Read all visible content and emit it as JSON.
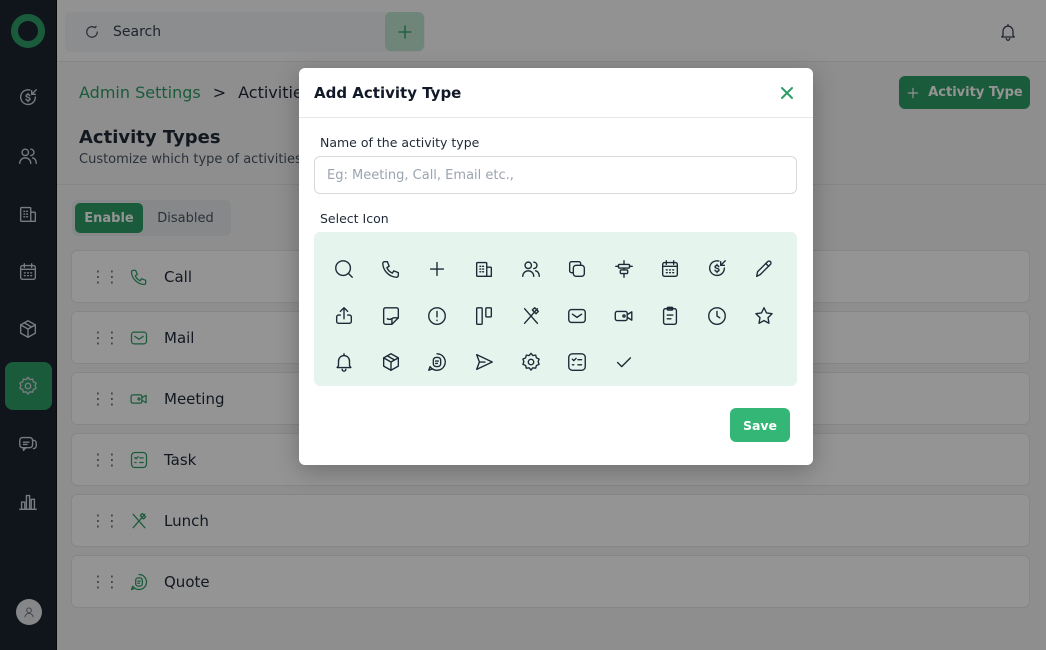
{
  "topbar": {
    "search_placeholder": "Search"
  },
  "breadcrumb": {
    "parent": "Admin Settings",
    "separator": ">",
    "current": "Activities"
  },
  "header": {
    "add_button_label": "Activity Type",
    "title": "Activity Types",
    "subtitle": "Customize which type of activities y"
  },
  "toggle": {
    "enable_label": "Enable",
    "disabled_label": "Disabled"
  },
  "activity_rows": [
    {
      "label": "Call",
      "icon": "phone-icon"
    },
    {
      "label": "Mail",
      "icon": "mail-icon"
    },
    {
      "label": "Meeting",
      "icon": "video-icon"
    },
    {
      "label": "Task",
      "icon": "task-icon"
    },
    {
      "label": "Lunch",
      "icon": "cutlery-icon"
    },
    {
      "label": "Quote",
      "icon": "quote-icon"
    }
  ],
  "modal": {
    "title": "Add Activity Type",
    "name_label": "Name of the activity type",
    "name_value": "",
    "name_placeholder": "Eg: Meeting, Call, Email etc.,",
    "icon_label": "Select Icon",
    "save_label": "Save",
    "icons": [
      "search-icon",
      "phone-icon",
      "plus-icon",
      "building-icon",
      "users-icon",
      "copy-icon",
      "align-center-icon",
      "calendar-icon",
      "dollar-refund-icon",
      "pencil-icon",
      "upload-icon",
      "sticky-note-icon",
      "alert-circle-icon",
      "columns-icon",
      "cutlery-icon",
      "mail-icon",
      "video-icon",
      "clipboard-icon",
      "clock-icon",
      "star-icon",
      "bell-icon",
      "box-icon",
      "quote-icon",
      "send-icon",
      "gear-icon",
      "task-icon",
      "check-icon"
    ]
  },
  "colors": {
    "brand_green": "#2e9e66",
    "sidebar_bg": "#1c2530",
    "icon_grid_bg": "#e5f4ec"
  }
}
